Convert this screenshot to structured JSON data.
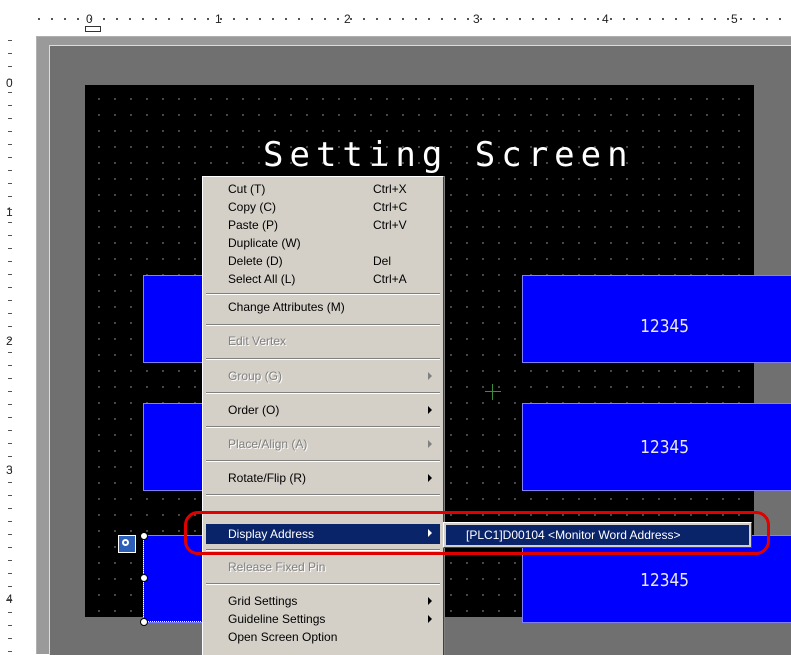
{
  "ruler": {
    "top_numbers": [
      "0",
      "1",
      "2",
      "3",
      "4",
      "5"
    ],
    "left_numbers": [
      "0",
      "1",
      "2",
      "3",
      "4"
    ]
  },
  "screen": {
    "title": "Setting Screen",
    "values": [
      "12345",
      "12345",
      "12345"
    ]
  },
  "context_menu": {
    "items": [
      {
        "label": "Cut (T)",
        "shortcut": "Ctrl+X"
      },
      {
        "label": "Copy (C)",
        "shortcut": "Ctrl+C"
      },
      {
        "label": "Paste (P)",
        "shortcut": "Ctrl+V"
      },
      {
        "label": "Duplicate (W)",
        "shortcut": ""
      },
      {
        "label": "Delete (D)",
        "shortcut": "Del"
      },
      {
        "label": "Select All (L)",
        "shortcut": "Ctrl+A"
      },
      {
        "label": "Change Attributes (M)"
      },
      {
        "label": "Edit Vertex"
      },
      {
        "label": "Group (G)"
      },
      {
        "label": "Order (O)"
      },
      {
        "label": "Place/Align (A)"
      },
      {
        "label": "Rotate/Flip (R)"
      },
      {
        "label": "Display Address"
      },
      {
        "label": "Release Fixed Pin"
      },
      {
        "label": "Grid Settings"
      },
      {
        "label": "Guideline Settings"
      },
      {
        "label": "Open Screen Option"
      }
    ],
    "submenu_item": "[PLC1]D00104 <Monitor Word Address>"
  },
  "colors": {
    "screen_bg": "#000000",
    "part_fill": "#0000ff",
    "menu_highlight": "#0a246a",
    "callout": "#e00000"
  }
}
